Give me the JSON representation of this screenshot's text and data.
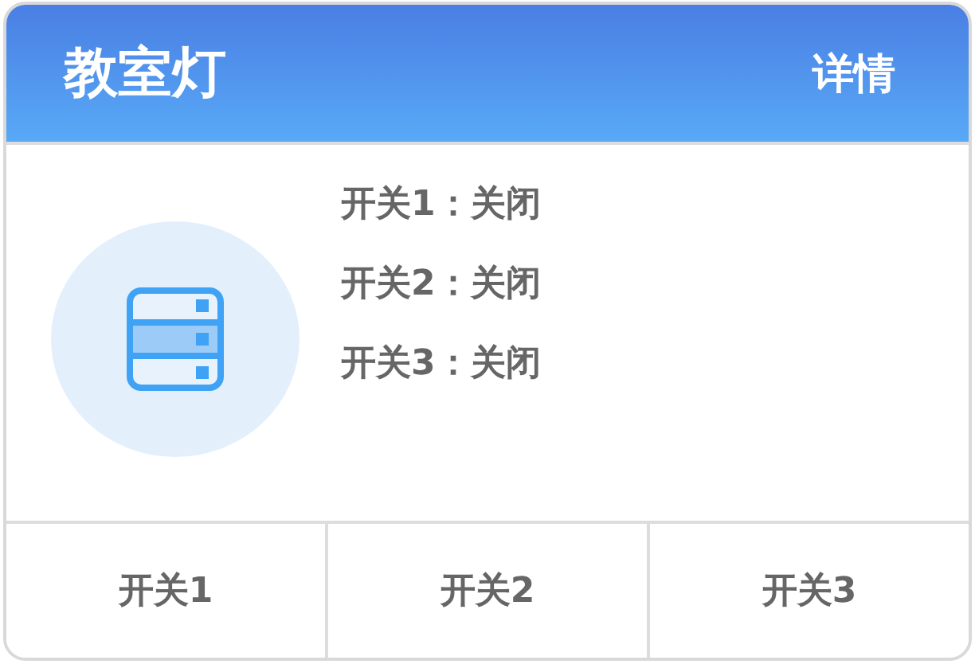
{
  "card": {
    "title": "教室灯",
    "detail_link": "详情"
  },
  "status_lines": [
    "开关1：关闭",
    "开关2：关闭",
    "开关3：关闭"
  ],
  "buttons": [
    "开关1",
    "开关2",
    "开关3"
  ]
}
